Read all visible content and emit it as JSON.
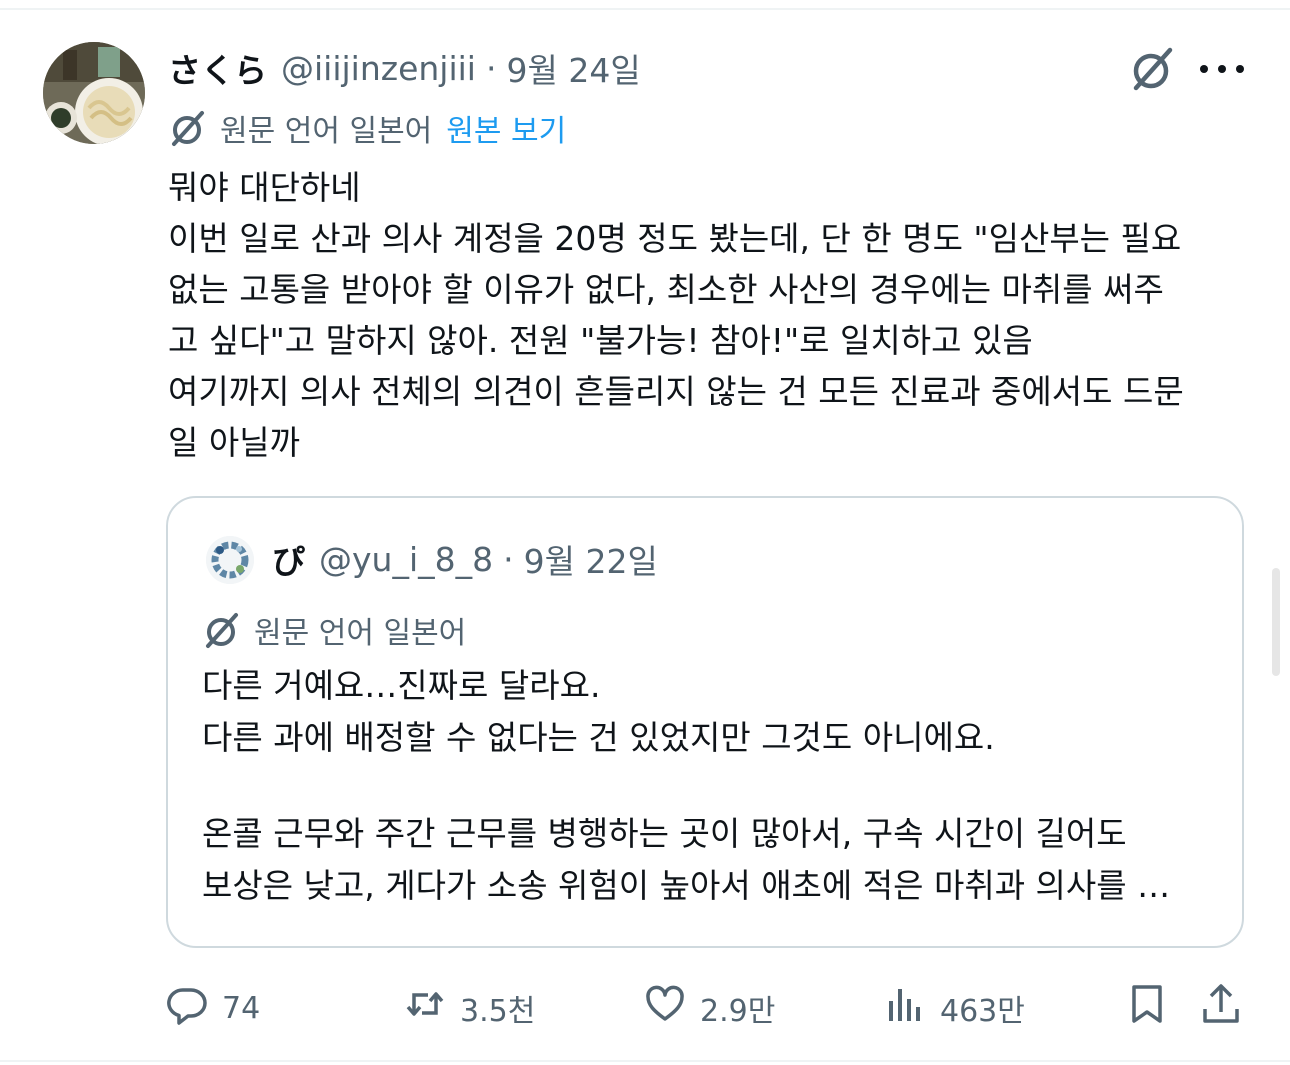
{
  "post": {
    "display_name": "さくら",
    "handle": "@iiijinzenjiii",
    "separator": "·",
    "date": "9월 24일",
    "translation": {
      "label": "원문 언어 일본어",
      "link": "원본 보기"
    },
    "body_lines": [
      "뭐야 대단하네",
      "이번 일로 산과 의사 계정을 20명 정도 봤는데, 단 한 명도 \"임산부는 필요",
      "없는 고통을 받아야 할 이유가 없다, 최소한 사산의 경우에는 마취를 써주",
      "고 싶다\"고 말하지 않아. 전원 \"불가능! 참아!\"로 일치하고 있음",
      "여기까지 의사 전체의 의견이 흔들리지 않는 건 모든 진료과 중에서도 드문",
      "일 아닐까"
    ]
  },
  "quote": {
    "display_name": "ぴ",
    "handle": "@yu_i_8_8",
    "separator": "·",
    "date": "9월 22일",
    "translation_label": "원문 언어 일본어",
    "body_lines": [
      "다른 거예요…진짜로 달라요.",
      "다른 과에 배정할 수 없다는 건 있었지만 그것도 아니에요.",
      "",
      "온콜 근무와 주간 근무를 병행하는 곳이 많아서, 구속 시간이 길어도",
      "보상은 낮고, 게다가 소송 위험이 높아서 애초에 적은 마취과 의사를 …"
    ]
  },
  "actions": {
    "replies": "74",
    "reposts": "3.5천",
    "likes": "2.9만",
    "views": "463만"
  },
  "icons": {
    "grok": "grok-icon",
    "more": "more-icon",
    "translate": "grok-translate-icon",
    "reply": "reply-icon",
    "repost": "repost-icon",
    "like": "heart-icon",
    "views": "views-icon",
    "bookmark": "bookmark-icon",
    "share": "share-icon"
  },
  "colors": {
    "text": "#0f1419",
    "secondary": "#536471",
    "link": "#1d9bf0",
    "border": "#cfd9de"
  }
}
